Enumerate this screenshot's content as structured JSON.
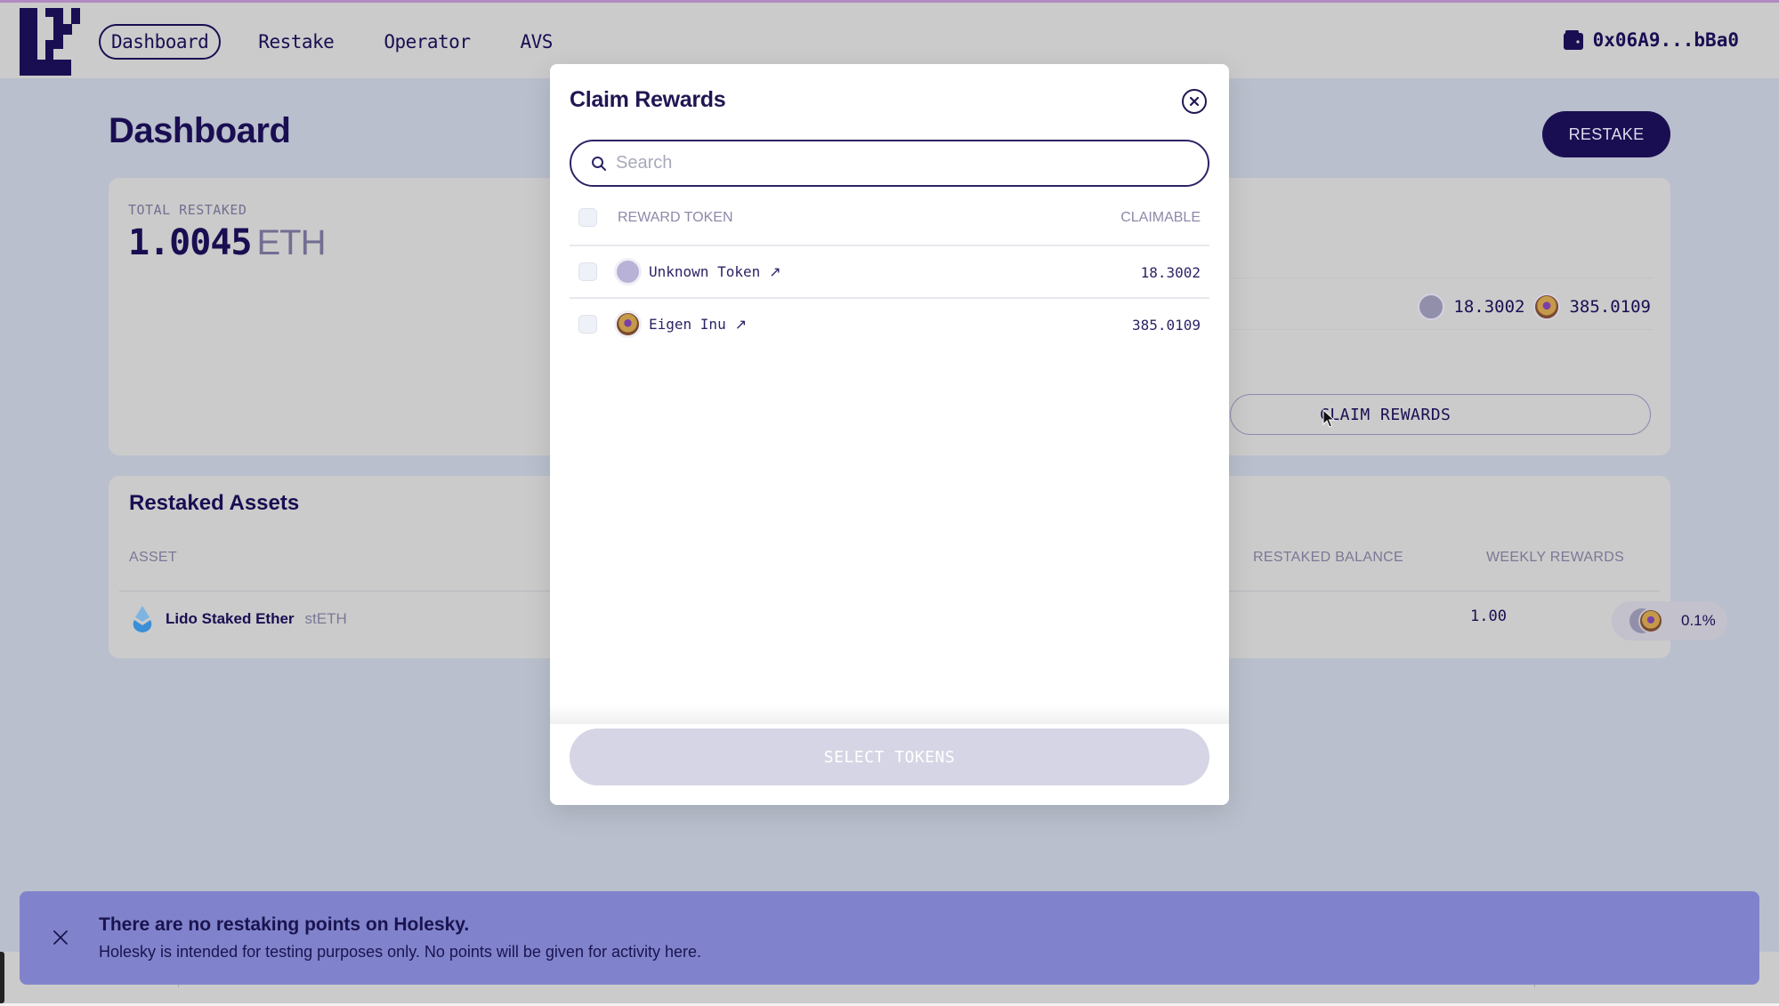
{
  "header": {
    "nav": [
      {
        "label": "Dashboard",
        "active": true
      },
      {
        "label": "Restake",
        "active": false
      },
      {
        "label": "Operator",
        "active": false
      },
      {
        "label": "AVS",
        "active": false
      }
    ],
    "wallet_address": "0x06A9...bBa0"
  },
  "page": {
    "title": "Dashboard",
    "restake_button": "RESTAKE"
  },
  "summary": {
    "total_label": "TOTAL RESTAKED",
    "total_value": "1.0045",
    "total_unit": "ETH",
    "rewards": [
      {
        "token": "Unknown Token",
        "amount": "18.3002"
      },
      {
        "token": "Eigen Inu",
        "amount": "385.0109"
      }
    ],
    "claim_button": "CLAIM REWARDS"
  },
  "assets": {
    "title": "Restaked Assets",
    "columns": [
      "ASSET",
      "RESTAKED BALANCE",
      "WEEKLY REWARDS"
    ],
    "rows": [
      {
        "name": "Lido Staked Ether",
        "symbol": "stETH",
        "balance": "1.00",
        "weekly_rewards": "0.1%"
      }
    ]
  },
  "modal": {
    "title": "Claim Rewards",
    "search_placeholder": "Search",
    "search_value": "",
    "columns": {
      "token": "REWARD TOKEN",
      "claimable": "CLAIMABLE"
    },
    "rows": [
      {
        "name": "Unknown Token",
        "claimable": "18.3002",
        "checked": false
      },
      {
        "name": "Eigen Inu",
        "claimable": "385.0109",
        "checked": false
      }
    ],
    "submit_button": "SELECT TOKENS"
  },
  "banner": {
    "title": "There are no restaking points on Holesky.",
    "text": "Holesky is intended for testing purposes only. No points will be given for activity here."
  },
  "colors": {
    "brand": "#1a0e52",
    "banner": "#8083cb",
    "disabled_button": "#d6d5e5"
  }
}
